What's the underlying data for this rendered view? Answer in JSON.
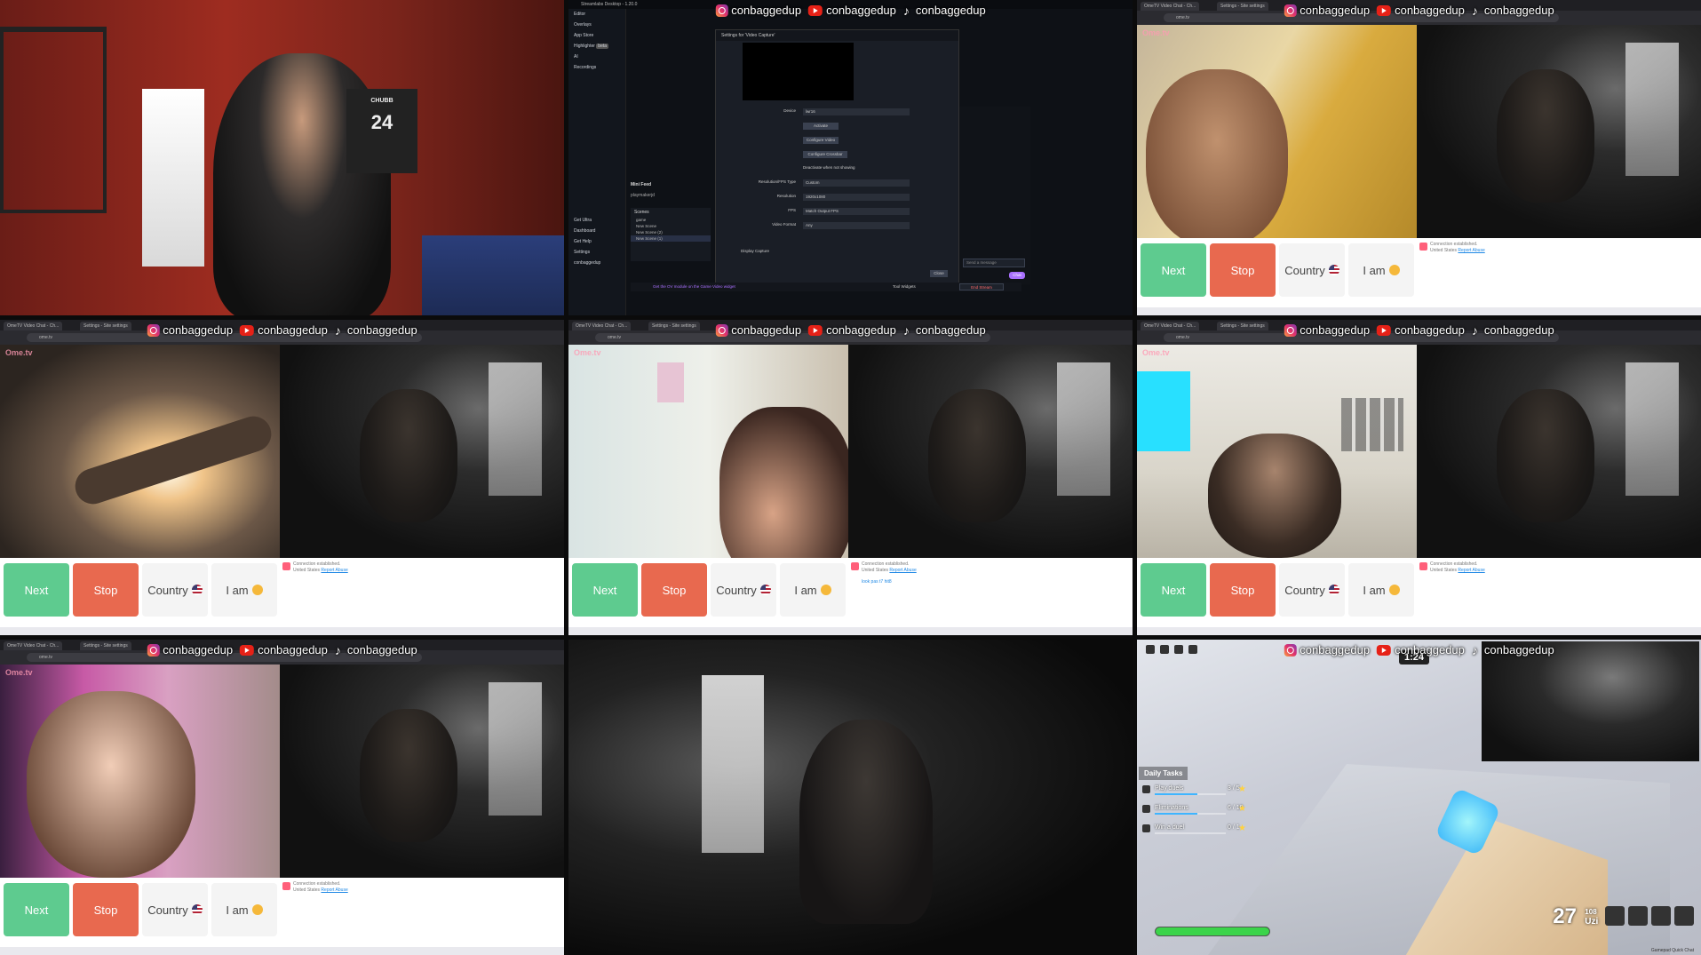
{
  "overlay": {
    "instagram_handle": "conbaggedup",
    "youtube_handle": "conbaggedup",
    "tiktok_handle": "conbaggedup"
  },
  "browser": {
    "tab_title": "OmeTV Video Chat - Ch...",
    "tab2_title": "Settings - Site settings",
    "url": "ome.tv"
  },
  "ome_controls": {
    "next_label": "Next",
    "stop_label": "Stop",
    "country_label": "Country",
    "iam_label": "I am"
  },
  "chat": {
    "line1": "Connection established.",
    "line2_prefix": "United States",
    "line2_link": "Report Abuse",
    "extra_message": "look pas t7 hit8"
  },
  "obs": {
    "window_title": "Streamlabs Desktop - 1.20.0",
    "sidebar": [
      "Editor",
      "Overlays",
      "App Store",
      "Highlighter",
      "AI",
      "Recordings",
      "Get Ultra",
      "Dashboard",
      "Get Help",
      "Settings",
      "conbaggedup"
    ],
    "highlighter_badge": "beta",
    "dialog_title": "Settings for 'Video Capture'",
    "rows": [
      {
        "label": "Device",
        "value": "lwr16"
      },
      {
        "label": "Resolution/FPS Type",
        "value": "Custom"
      },
      {
        "label": "Resolution",
        "value": "1920x1080"
      },
      {
        "label": "FPS",
        "value": "Match Output FPS"
      },
      {
        "label": "Video Format",
        "value": "Any"
      }
    ],
    "buttons": [
      "Activate",
      "Configure Video",
      "Configure Crossbar"
    ],
    "deactivate_label": "Deactivate when not showing",
    "display_capture_label": "Display Capture",
    "close_label": "Close",
    "mini_feed_label": "Mini Feed",
    "mini_feed_entry": "playmakerjd",
    "scenes_label": "Scenes",
    "scenes": [
      "game",
      "New Scene",
      "New Scene (2)",
      "New Scene (1)"
    ],
    "chat_placeholder": "Send a message",
    "chat_button": "Chat",
    "bottom_link": "Get the OV module on the Game Video widget",
    "tool_widgets": "Tool Widgets",
    "end_stream": "End Stream"
  },
  "game": {
    "timer": "1:24",
    "daily_tasks_title": "Daily Tasks",
    "tasks": [
      {
        "name": "Play duels",
        "value": "3 / 5",
        "progress": 0.6
      },
      {
        "name": "Eliminations",
        "value": "6 / 10",
        "progress": 0.6
      },
      {
        "name": "Win a duel",
        "value": "0 / 1",
        "progress": 0.0
      }
    ],
    "health": 1.0,
    "ammo": "27",
    "reserve": "108",
    "weapon_name": "Uzi",
    "hint": "Gamepad   Quick Chat"
  },
  "jersey": {
    "number": "24",
    "name": "CHUBB"
  }
}
